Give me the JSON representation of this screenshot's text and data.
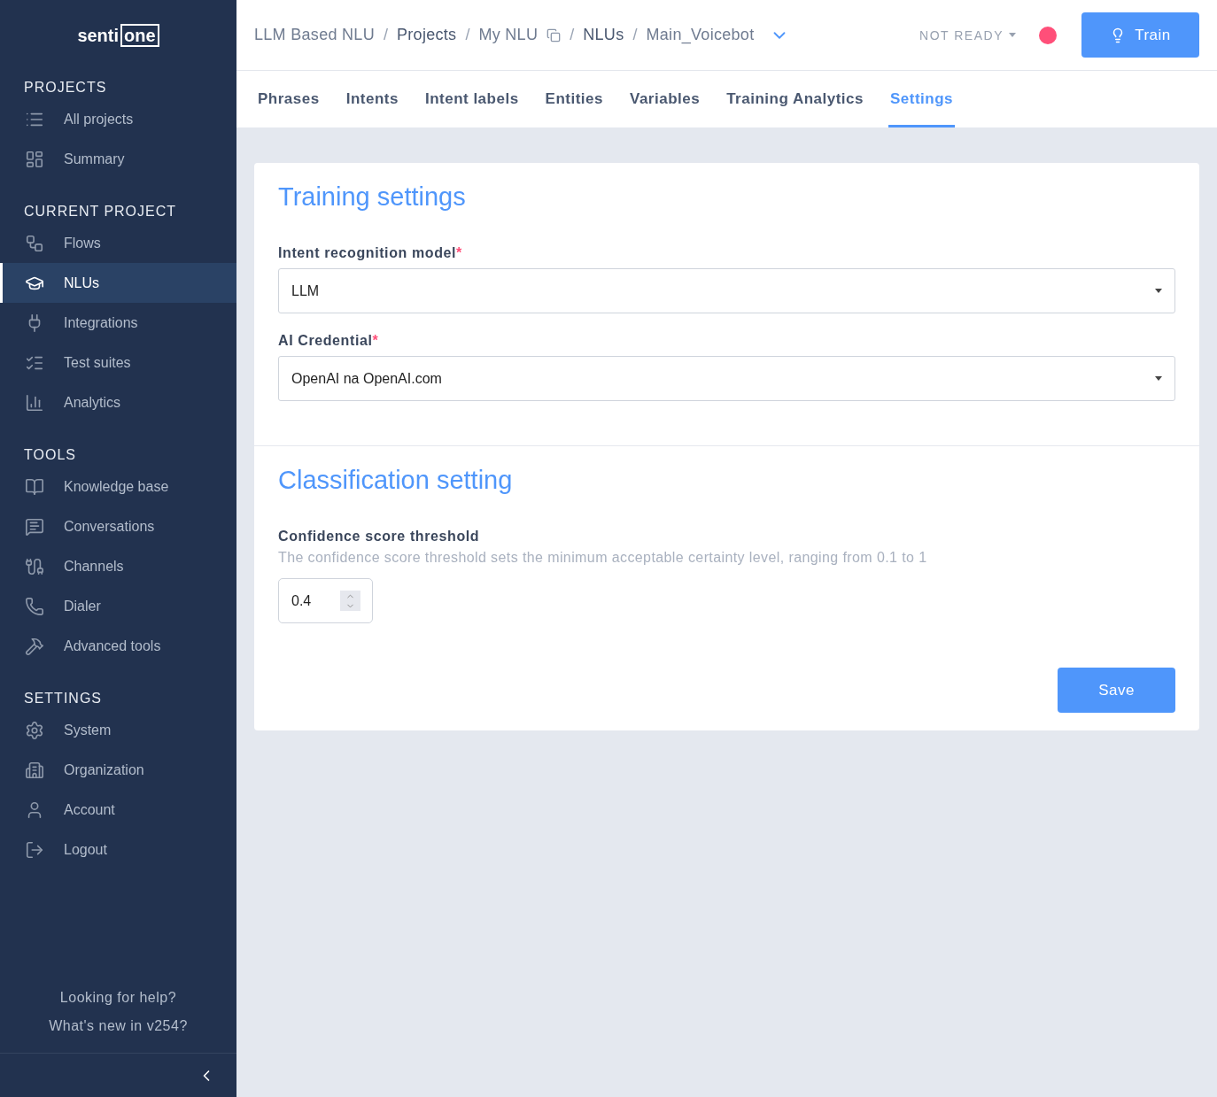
{
  "logo": {
    "left": "senti",
    "right": "one"
  },
  "sidebar": {
    "sections": [
      {
        "title": "PROJECTS",
        "items": [
          {
            "label": "All projects",
            "selected": false
          },
          {
            "label": "Summary",
            "selected": false
          }
        ]
      },
      {
        "title": "CURRENT PROJECT",
        "items": [
          {
            "label": "Flows",
            "selected": false
          },
          {
            "label": "NLUs",
            "selected": true
          },
          {
            "label": "Integrations",
            "selected": false
          },
          {
            "label": "Test suites",
            "selected": false
          },
          {
            "label": "Analytics",
            "selected": false
          }
        ]
      },
      {
        "title": "TOOLS",
        "items": [
          {
            "label": "Knowledge base",
            "selected": false
          },
          {
            "label": "Conversations",
            "selected": false
          },
          {
            "label": "Channels",
            "selected": false
          },
          {
            "label": "Dialer",
            "selected": false
          },
          {
            "label": "Advanced tools",
            "selected": false
          }
        ]
      },
      {
        "title": "SETTINGS",
        "items": [
          {
            "label": "System",
            "selected": false
          },
          {
            "label": "Organization",
            "selected": false
          },
          {
            "label": "Account",
            "selected": false
          },
          {
            "label": "Logout",
            "selected": false
          }
        ]
      }
    ],
    "help_links": [
      "Looking for help?",
      "What's new in v254?"
    ]
  },
  "breadcrumbs": [
    "LLM Based NLU",
    "Projects",
    "My NLU",
    "NLUs",
    "Main_Voicebot"
  ],
  "breadcrumb_separator": "/",
  "required_mark": "*",
  "status": {
    "label": "NOT READY",
    "color": "#ff4f79"
  },
  "train_button": "Train",
  "tabs": [
    {
      "label": "Phrases",
      "selected": false
    },
    {
      "label": "Intents",
      "selected": false
    },
    {
      "label": "Intent labels",
      "selected": false
    },
    {
      "label": "Entities",
      "selected": false
    },
    {
      "label": "Variables",
      "selected": false
    },
    {
      "label": "Training Analytics",
      "selected": false
    },
    {
      "label": "Settings",
      "selected": true
    }
  ],
  "sections": [
    {
      "title": "Training settings",
      "fields": [
        {
          "kind": "select",
          "label": "Intent recognition model",
          "required": true,
          "value": "LLM"
        },
        {
          "kind": "select",
          "label": "AI Credential",
          "required": true,
          "value": "OpenAI na OpenAI.com"
        }
      ]
    },
    {
      "title": "Classification setting",
      "fields": [
        {
          "kind": "number",
          "label": "Confidence score threshold",
          "required": false,
          "hint": "The confidence score threshold sets the minimum acceptable certainty level, ranging from 0.1 to 1",
          "value": "0.4"
        }
      ]
    }
  ],
  "save_button": "Save"
}
